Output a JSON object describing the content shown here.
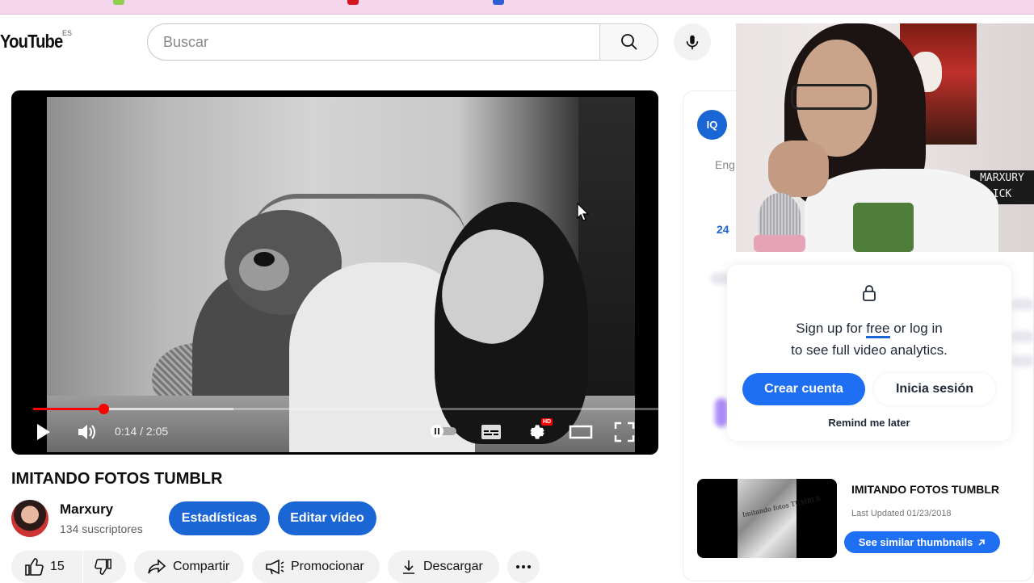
{
  "header": {
    "logo_text": "YouTube",
    "country_code": "ES",
    "search_placeholder": "Buscar"
  },
  "player": {
    "current_time": "0:14",
    "duration": "2:05",
    "time_display": "0:14 / 2:05",
    "progress_fraction": 0.112,
    "buffered_fraction": 0.32,
    "hd_badge": "HD"
  },
  "video": {
    "title": "IMITANDO FOTOS TUMBLR",
    "channel_name": "Marxury",
    "subscribers": "134 suscriptores",
    "stats_button": "Estadísticas",
    "edit_button": "Editar vídeo",
    "likes": "15",
    "share_label": "Compartir",
    "promote_label": "Promocionar",
    "download_label": "Descargar"
  },
  "extension": {
    "logo_text": "IQ",
    "tab_partial": "Eng",
    "period_partial": "24",
    "signup_line1_pre": "Sign up for ",
    "signup_free": "free",
    "signup_line1_post": " or log in",
    "signup_line2": "to see full video analytics.",
    "create_account": "Crear cuenta",
    "login": "Inicia sesión",
    "remind_later": "Remind me later"
  },
  "related": {
    "title": "IMITANDO FOTOS TUMBLR",
    "updated": "Last Updated 01/23/2018",
    "similar_button": "See similar thumbnails",
    "thumb_text": "Imitando fotos TUMBLR"
  },
  "webcam": {
    "sign_line1": "MARXURY",
    "sign_line2": "ICK"
  },
  "colors": {
    "accent_blue": "#1a66d4",
    "progress_red": "#ff0000",
    "browser_strip": "#f6d6ec"
  }
}
